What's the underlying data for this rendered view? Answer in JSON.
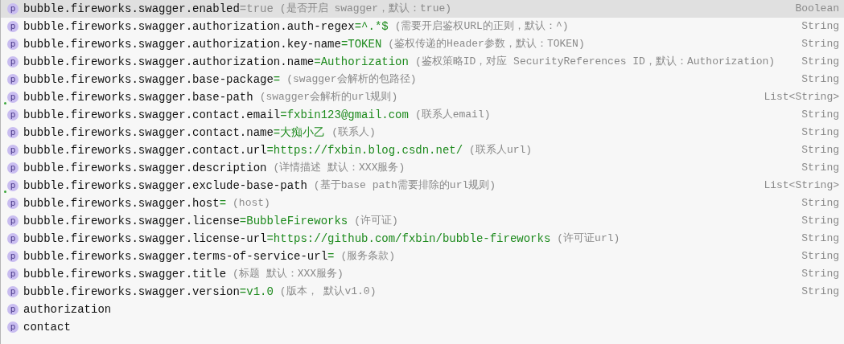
{
  "completion_list": [
    {
      "icon": "p",
      "key": "bubble.fireworks.swagger.enabled",
      "value": {
        "text": "=true",
        "muted": true
      },
      "description": "(是否开启 swagger，默认：true)",
      "type": "Boolean",
      "selected": true,
      "marker": false
    },
    {
      "icon": "p",
      "key": "bubble.fireworks.swagger.authorization.auth-regex",
      "value": {
        "text": "=^.*$",
        "muted": false
      },
      "description": "(需要开启鉴权URL的正则，默认：^)",
      "type": "String",
      "selected": false,
      "marker": false
    },
    {
      "icon": "p",
      "key": "bubble.fireworks.swagger.authorization.key-name",
      "value": {
        "text": "=TOKEN",
        "muted": false
      },
      "description": "(鉴权传递的Header参数，默认：TOKEN)",
      "type": "String",
      "selected": false,
      "marker": false
    },
    {
      "icon": "p",
      "key": "bubble.fireworks.swagger.authorization.name",
      "value": {
        "text": "=Authorization",
        "muted": false
      },
      "description": "(鉴权策略ID，对应 SecurityReferences ID，默认：Authorization)",
      "type": "String",
      "selected": false,
      "marker": false
    },
    {
      "icon": "p",
      "key": "bubble.fireworks.swagger.base-package",
      "value": {
        "text": "=",
        "muted": false
      },
      "description": "(swagger会解析的包路径)",
      "type": "String",
      "selected": false,
      "marker": false
    },
    {
      "icon": "p",
      "key": "bubble.fireworks.swagger.base-path",
      "description": "(swagger会解析的url规则)",
      "type": "List<String>",
      "selected": false,
      "marker": true
    },
    {
      "icon": "p",
      "key": "bubble.fireworks.swagger.contact.email",
      "value": {
        "text": "=fxbin123@gmail.com",
        "muted": false
      },
      "description": "(联系人email)",
      "type": "String",
      "selected": false,
      "marker": false
    },
    {
      "icon": "p",
      "key": "bubble.fireworks.swagger.contact.name",
      "value": {
        "text": "=大痴小乙",
        "muted": false
      },
      "description": "(联系人)",
      "type": "String",
      "selected": false,
      "marker": false
    },
    {
      "icon": "p",
      "key": "bubble.fireworks.swagger.contact.url",
      "value": {
        "text": "=https://fxbin.blog.csdn.net/",
        "muted": false
      },
      "description": "(联系人url)",
      "type": "String",
      "selected": false,
      "marker": false
    },
    {
      "icon": "p",
      "key": "bubble.fireworks.swagger.description",
      "description": "(详情描述 默认：XXX服务)",
      "type": "String",
      "selected": false,
      "marker": false
    },
    {
      "icon": "p",
      "key": "bubble.fireworks.swagger.exclude-base-path",
      "description": "(基于base path需要排除的url规则)",
      "type": "List<String>",
      "selected": false,
      "marker": true
    },
    {
      "icon": "p",
      "key": "bubble.fireworks.swagger.host",
      "value": {
        "text": "=",
        "muted": false
      },
      "description": "(host)",
      "type": "String",
      "selected": false,
      "marker": false
    },
    {
      "icon": "p",
      "key": "bubble.fireworks.swagger.license",
      "value": {
        "text": "=BubbleFireworks",
        "muted": false
      },
      "description": "(许可证)",
      "type": "String",
      "selected": false,
      "marker": false
    },
    {
      "icon": "p",
      "key": "bubble.fireworks.swagger.license-url",
      "value": {
        "text": "=https://github.com/fxbin/bubble-fireworks",
        "muted": false
      },
      "description": "(许可证url)",
      "type": "String",
      "selected": false,
      "marker": false
    },
    {
      "icon": "p",
      "key": "bubble.fireworks.swagger.terms-of-service-url",
      "value": {
        "text": "=",
        "muted": false
      },
      "description": "(服务条款)",
      "type": "String",
      "selected": false,
      "marker": false
    },
    {
      "icon": "p",
      "key": "bubble.fireworks.swagger.title",
      "description": "(标题 默认：XXX服务)",
      "type": "String",
      "selected": false,
      "marker": false
    },
    {
      "icon": "p",
      "key": "bubble.fireworks.swagger.version",
      "value": {
        "text": "=v1.0",
        "muted": false
      },
      "description": "(版本， 默认v1.0)",
      "type": "String",
      "selected": false,
      "marker": false
    },
    {
      "icon": "p",
      "key": "authorization",
      "selected": false,
      "marker": false
    },
    {
      "icon": "p",
      "key": "contact",
      "selected": false,
      "marker": false
    }
  ]
}
